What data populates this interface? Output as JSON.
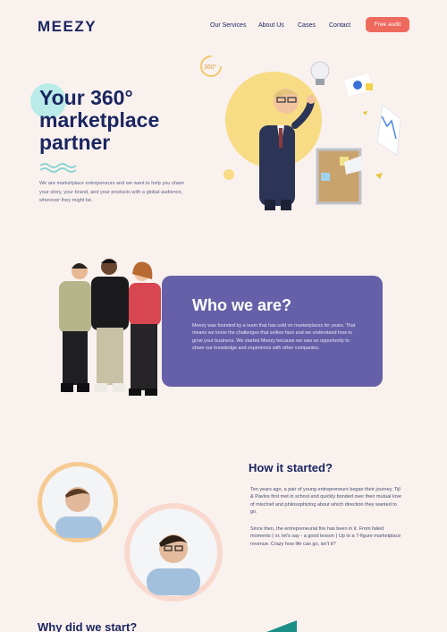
{
  "header": {
    "logo": "MEEZY",
    "nav": [
      "Our Services",
      "About Us",
      "Cases",
      "Contact"
    ],
    "cta_label": "Free audit"
  },
  "hero": {
    "title_lines": [
      "Your 360°",
      "marketplace",
      "partner"
    ],
    "description": "We are marketplace entrepeneurs and we want to help you share your story, your brand, and your products with a global audience, wherever they might be.",
    "badge_text": "360°"
  },
  "who": {
    "title": "Who we are?",
    "description": "Meezy was founded by a team that has sold on marketplaces for years. That means we know the challenges that sellers face and we understand how to grow your business. We started Meezy because we saw an opportunity to share our knowledge and experience with other companies."
  },
  "how": {
    "title": "How it started?",
    "paragraphs": [
      "Ten years ago, a pair of young entrepreneurs began their journey. Tijl & Pavlos first met in school and quickly bonded over their mutual love of mischief and philosophizing about which direction they wanted to go.",
      "Since then, the entrepreneurial fire has been in it. From failed moments ( or, let's say - a good lesson ) Up to a 7-figure marketplace revenue. Crazy how life can go, isn't it?"
    ]
  },
  "why": {
    "title": "Why did we start?"
  },
  "colors": {
    "accent": "#ee6a5f",
    "navy": "#1b2660",
    "purple": "#6660a8",
    "background": "#f9f1ee",
    "yellow": "#f7dc85",
    "mint": "#b9ece8"
  }
}
